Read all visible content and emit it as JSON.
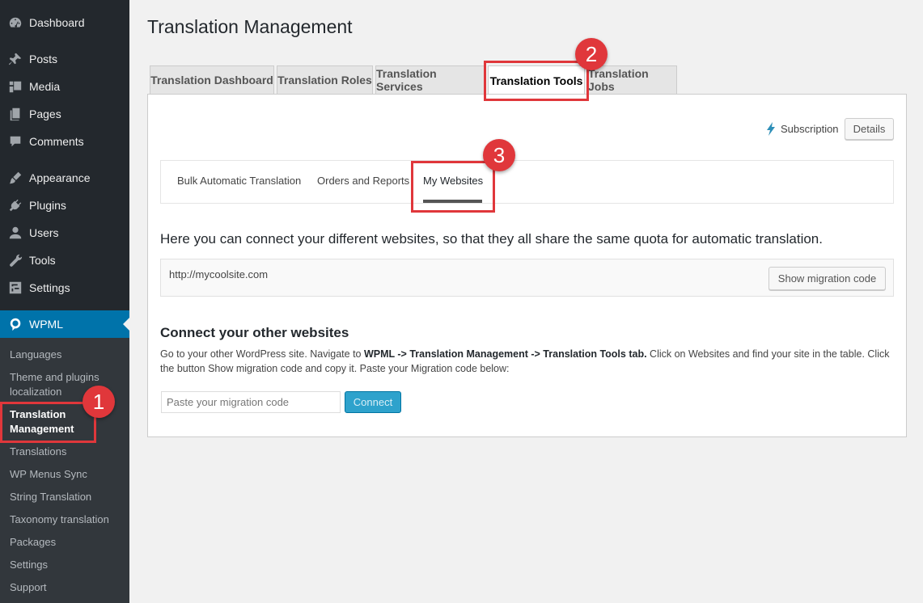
{
  "sidebar": {
    "items": [
      {
        "label": "Dashboard",
        "icon": "dashboard-icon"
      },
      {
        "label": "Posts",
        "icon": "pin-icon"
      },
      {
        "label": "Media",
        "icon": "media-icon"
      },
      {
        "label": "Pages",
        "icon": "pages-icon"
      },
      {
        "label": "Comments",
        "icon": "comment-icon"
      },
      {
        "label": "Appearance",
        "icon": "brush-icon"
      },
      {
        "label": "Plugins",
        "icon": "plugin-icon"
      },
      {
        "label": "Users",
        "icon": "user-icon"
      },
      {
        "label": "Tools",
        "icon": "wrench-icon"
      },
      {
        "label": "Settings",
        "icon": "settings-icon"
      }
    ],
    "wpml": {
      "label": "WPML",
      "icon": "wpml-icon"
    },
    "submenu": [
      "Languages",
      "Theme and plugins localization",
      "Translation Management",
      "Translations",
      "WP Menus Sync",
      "String Translation",
      "Taxonomy translation",
      "Packages",
      "Settings",
      "Support"
    ]
  },
  "page": {
    "title": "Translation Management",
    "tabs": [
      "Translation Dashboard",
      "Translation Roles",
      "Translation Services",
      "Translation Tools",
      "Translation Jobs"
    ],
    "active_tab": "Translation Tools",
    "subscription_label": "Subscription",
    "details_label": "Details",
    "subtabs": [
      "Bulk Automatic Translation",
      "Orders and Reports",
      "My Websites"
    ],
    "active_subtab": "My Websites",
    "intro": "Here you can connect your different websites, so that they all share the same quota for automatic translation.",
    "site_url": "http://mycoolsite.com",
    "show_code_label": "Show migration code",
    "connect_title": "Connect your other websites",
    "instructions": {
      "p1": "Go to your other WordPress site. Navigate to ",
      "b1": "WPML -> Translation Management -> Translation Tools tab.",
      "p2": " Click on Websites and find your site in the table. Click the button Show migration code and copy it. Paste your Migration code below:"
    },
    "input_placeholder": "Paste your migration code",
    "connect_label": "Connect"
  },
  "annotations": {
    "badge1": "1",
    "badge2": "2",
    "badge3": "3",
    "color": "#e0373b"
  },
  "colors": {
    "sidebar_bg": "#23282d",
    "submenu_bg": "#32373c",
    "accent": "#0073aa",
    "connect_button": "#2ea2cc"
  }
}
